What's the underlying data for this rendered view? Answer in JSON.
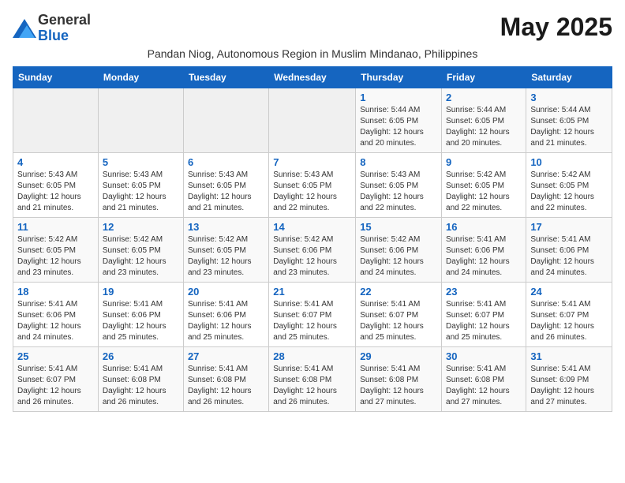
{
  "header": {
    "logo_line1": "General",
    "logo_line2": "Blue",
    "month_year": "May 2025",
    "subtitle": "Pandan Niog, Autonomous Region in Muslim Mindanao, Philippines"
  },
  "days_of_week": [
    "Sunday",
    "Monday",
    "Tuesday",
    "Wednesday",
    "Thursday",
    "Friday",
    "Saturday"
  ],
  "weeks": [
    [
      {
        "num": "",
        "info": ""
      },
      {
        "num": "",
        "info": ""
      },
      {
        "num": "",
        "info": ""
      },
      {
        "num": "",
        "info": ""
      },
      {
        "num": "1",
        "info": "Sunrise: 5:44 AM\nSunset: 6:05 PM\nDaylight: 12 hours\nand 20 minutes."
      },
      {
        "num": "2",
        "info": "Sunrise: 5:44 AM\nSunset: 6:05 PM\nDaylight: 12 hours\nand 20 minutes."
      },
      {
        "num": "3",
        "info": "Sunrise: 5:44 AM\nSunset: 6:05 PM\nDaylight: 12 hours\nand 21 minutes."
      }
    ],
    [
      {
        "num": "4",
        "info": "Sunrise: 5:43 AM\nSunset: 6:05 PM\nDaylight: 12 hours\nand 21 minutes."
      },
      {
        "num": "5",
        "info": "Sunrise: 5:43 AM\nSunset: 6:05 PM\nDaylight: 12 hours\nand 21 minutes."
      },
      {
        "num": "6",
        "info": "Sunrise: 5:43 AM\nSunset: 6:05 PM\nDaylight: 12 hours\nand 21 minutes."
      },
      {
        "num": "7",
        "info": "Sunrise: 5:43 AM\nSunset: 6:05 PM\nDaylight: 12 hours\nand 22 minutes."
      },
      {
        "num": "8",
        "info": "Sunrise: 5:43 AM\nSunset: 6:05 PM\nDaylight: 12 hours\nand 22 minutes."
      },
      {
        "num": "9",
        "info": "Sunrise: 5:42 AM\nSunset: 6:05 PM\nDaylight: 12 hours\nand 22 minutes."
      },
      {
        "num": "10",
        "info": "Sunrise: 5:42 AM\nSunset: 6:05 PM\nDaylight: 12 hours\nand 22 minutes."
      }
    ],
    [
      {
        "num": "11",
        "info": "Sunrise: 5:42 AM\nSunset: 6:05 PM\nDaylight: 12 hours\nand 23 minutes."
      },
      {
        "num": "12",
        "info": "Sunrise: 5:42 AM\nSunset: 6:05 PM\nDaylight: 12 hours\nand 23 minutes."
      },
      {
        "num": "13",
        "info": "Sunrise: 5:42 AM\nSunset: 6:05 PM\nDaylight: 12 hours\nand 23 minutes."
      },
      {
        "num": "14",
        "info": "Sunrise: 5:42 AM\nSunset: 6:06 PM\nDaylight: 12 hours\nand 23 minutes."
      },
      {
        "num": "15",
        "info": "Sunrise: 5:42 AM\nSunset: 6:06 PM\nDaylight: 12 hours\nand 24 minutes."
      },
      {
        "num": "16",
        "info": "Sunrise: 5:41 AM\nSunset: 6:06 PM\nDaylight: 12 hours\nand 24 minutes."
      },
      {
        "num": "17",
        "info": "Sunrise: 5:41 AM\nSunset: 6:06 PM\nDaylight: 12 hours\nand 24 minutes."
      }
    ],
    [
      {
        "num": "18",
        "info": "Sunrise: 5:41 AM\nSunset: 6:06 PM\nDaylight: 12 hours\nand 24 minutes."
      },
      {
        "num": "19",
        "info": "Sunrise: 5:41 AM\nSunset: 6:06 PM\nDaylight: 12 hours\nand 25 minutes."
      },
      {
        "num": "20",
        "info": "Sunrise: 5:41 AM\nSunset: 6:06 PM\nDaylight: 12 hours\nand 25 minutes."
      },
      {
        "num": "21",
        "info": "Sunrise: 5:41 AM\nSunset: 6:07 PM\nDaylight: 12 hours\nand 25 minutes."
      },
      {
        "num": "22",
        "info": "Sunrise: 5:41 AM\nSunset: 6:07 PM\nDaylight: 12 hours\nand 25 minutes."
      },
      {
        "num": "23",
        "info": "Sunrise: 5:41 AM\nSunset: 6:07 PM\nDaylight: 12 hours\nand 25 minutes."
      },
      {
        "num": "24",
        "info": "Sunrise: 5:41 AM\nSunset: 6:07 PM\nDaylight: 12 hours\nand 26 minutes."
      }
    ],
    [
      {
        "num": "25",
        "info": "Sunrise: 5:41 AM\nSunset: 6:07 PM\nDaylight: 12 hours\nand 26 minutes."
      },
      {
        "num": "26",
        "info": "Sunrise: 5:41 AM\nSunset: 6:08 PM\nDaylight: 12 hours\nand 26 minutes."
      },
      {
        "num": "27",
        "info": "Sunrise: 5:41 AM\nSunset: 6:08 PM\nDaylight: 12 hours\nand 26 minutes."
      },
      {
        "num": "28",
        "info": "Sunrise: 5:41 AM\nSunset: 6:08 PM\nDaylight: 12 hours\nand 26 minutes."
      },
      {
        "num": "29",
        "info": "Sunrise: 5:41 AM\nSunset: 6:08 PM\nDaylight: 12 hours\nand 27 minutes."
      },
      {
        "num": "30",
        "info": "Sunrise: 5:41 AM\nSunset: 6:08 PM\nDaylight: 12 hours\nand 27 minutes."
      },
      {
        "num": "31",
        "info": "Sunrise: 5:41 AM\nSunset: 6:09 PM\nDaylight: 12 hours\nand 27 minutes."
      }
    ]
  ]
}
